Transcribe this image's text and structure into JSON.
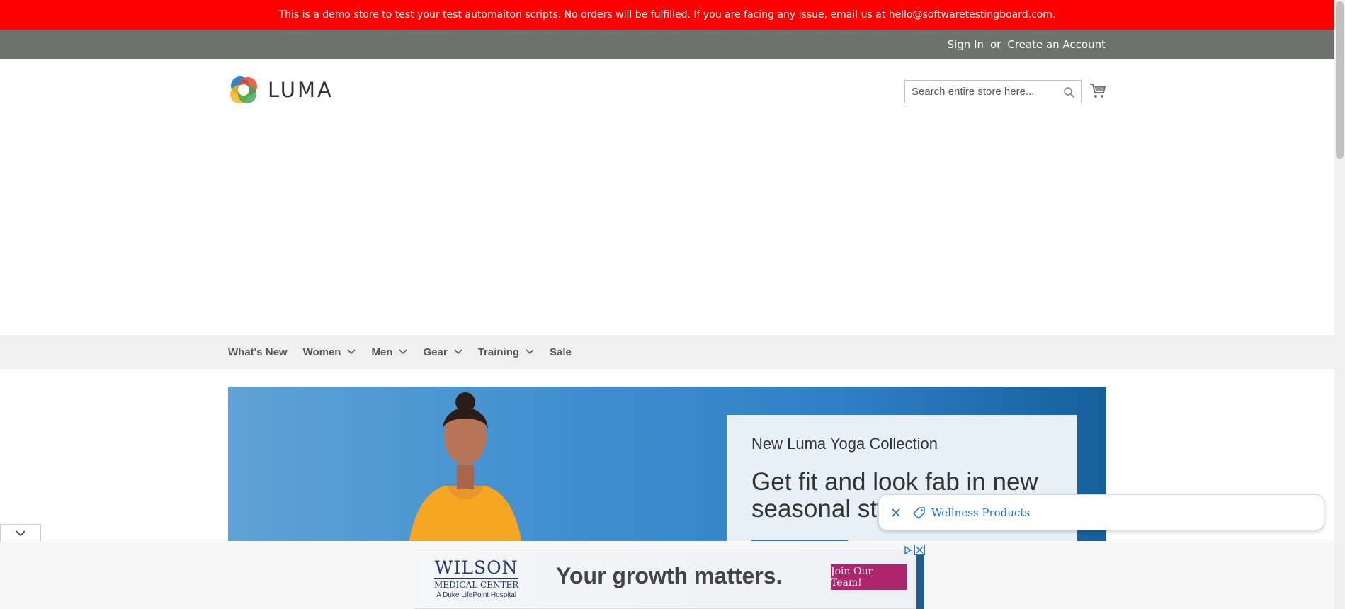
{
  "banner": {
    "text": "This is a demo store to test your test automaiton scripts. No orders will be fulfilled. If you are facing any issue, email us at hello@softwaretestingboard.com."
  },
  "header": {
    "sign_in": "Sign In",
    "or": "or",
    "create_account": "Create an Account",
    "logo_text": "LUMA",
    "search_placeholder": "Search entire store here...",
    "search_icon": "search-icon",
    "cart_icon": "cart-icon"
  },
  "nav": {
    "items": [
      {
        "label": "What's New",
        "has_dropdown": false
      },
      {
        "label": "Women",
        "has_dropdown": true
      },
      {
        "label": "Men",
        "has_dropdown": true
      },
      {
        "label": "Gear",
        "has_dropdown": true
      },
      {
        "label": "Training",
        "has_dropdown": true
      },
      {
        "label": "Sale",
        "has_dropdown": false
      }
    ]
  },
  "hero": {
    "subtitle": "New Luma Yoga Collection",
    "title": "Get fit and look fab in new seasonal styl"
  },
  "chip": {
    "label": "Wellness Products",
    "close_icon": "close-icon",
    "tag_icon": "tag-icon"
  },
  "ad": {
    "logo_line1": "WILSON",
    "logo_line2": "MEDICAL CENTER",
    "logo_line3": "A Duke LifePoint Hospital",
    "headline": "Your growth matters.",
    "cta": "Join Our Team!"
  },
  "colors": {
    "banner": "#ff0000",
    "topbar": "#6e716e",
    "nav_bg": "#f0f0f0",
    "link_blue": "#1a73e8",
    "ad_cta": "#b0246e"
  }
}
